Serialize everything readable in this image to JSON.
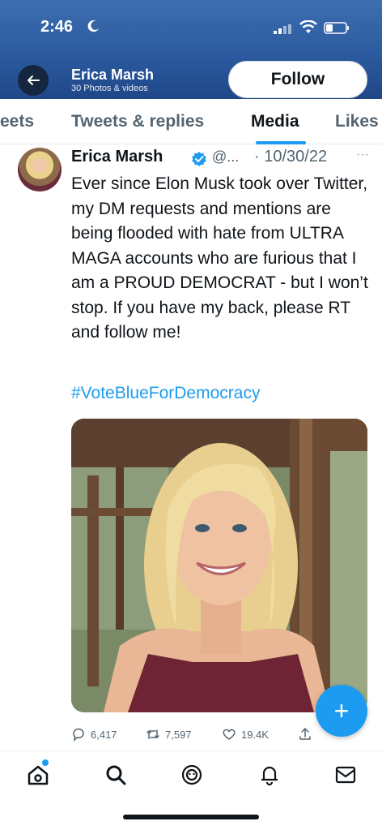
{
  "status_bar": {
    "time": "2:46"
  },
  "header": {
    "profile_name": "Erica Marsh",
    "profile_subtitle": "30 Photos & videos",
    "follow_label": "Follow"
  },
  "tabs": [
    {
      "label": "eets"
    },
    {
      "label": "Tweets & replies"
    },
    {
      "label": "Media",
      "active": true
    },
    {
      "label": "Likes"
    }
  ],
  "tweet": {
    "name": "Erica Marsh",
    "handle": "@...",
    "date": "· 10/30/22",
    "more": "···",
    "text": "Ever since Elon Musk took over Twitter, my DM requests and mentions are being flooded with hate from ULTRA MAGA accounts who are furious that I am a PROUD DEMOCRAT - but I won’t stop. If you have my back, please RT and follow me!",
    "hashtag": "#VoteBlueForDemocracy",
    "replies": "6,417",
    "retweets": "7,597",
    "likes": "19.4K"
  },
  "fab": {
    "label": "+"
  },
  "colors": {
    "accent": "#1d9bf0",
    "header_top": "#3d6fb0",
    "header_bottom": "#1f4788",
    "text": "#0f1419",
    "muted": "#536471"
  },
  "icons": [
    "moon-icon",
    "signal-icon",
    "wifi-icon",
    "battery-icon",
    "back-arrow-icon",
    "verified-icon",
    "reply-icon",
    "retweet-icon",
    "like-icon",
    "share-icon",
    "home-icon",
    "search-icon",
    "spaces-icon",
    "notifications-icon",
    "messages-icon"
  ]
}
